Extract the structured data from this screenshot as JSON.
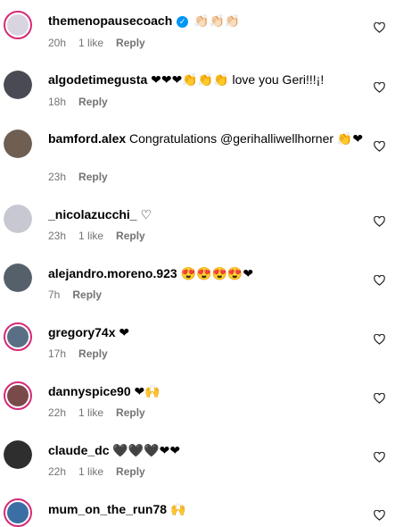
{
  "comments": [
    {
      "username": "themenopausecoach",
      "verified": true,
      "text": "👏🏻👏🏻👏🏻",
      "time": "20h",
      "likes": "1 like",
      "reply": "Reply",
      "avatar_color": "#d9d5e0"
    },
    {
      "username": "algodetimegusta",
      "verified": false,
      "text": "❤❤❤👏👏👏 love you Geri!!!¡!",
      "time": "18h",
      "likes": "",
      "reply": "Reply",
      "avatar_color": "#4a4a55"
    },
    {
      "username": "bamford.alex",
      "verified": false,
      "text": "Congratulations @gerihalliwellhorner 👏❤",
      "time": "23h",
      "likes": "",
      "reply": "Reply",
      "avatar_color": "#6e5f52"
    },
    {
      "username": "_nicolazucchi_",
      "verified": false,
      "text": "♡",
      "time": "23h",
      "likes": "1 like",
      "reply": "Reply",
      "avatar_color": "#c8c8d2"
    },
    {
      "username": "alejandro.moreno.923",
      "verified": false,
      "text": "😍😍😍😍❤",
      "time": "7h",
      "likes": "",
      "reply": "Reply",
      "avatar_color": "#55606a"
    },
    {
      "username": "gregory74x",
      "verified": false,
      "text": "❤",
      "time": "17h",
      "likes": "",
      "reply": "Reply",
      "avatar_color": "#5a6f85"
    },
    {
      "username": "dannyspice90",
      "verified": false,
      "text": "❤🙌",
      "time": "22h",
      "likes": "1 like",
      "reply": "Reply",
      "avatar_color": "#7a4a4a"
    },
    {
      "username": "claude_dc",
      "verified": false,
      "text": "🖤🖤🖤❤❤",
      "time": "22h",
      "likes": "1 like",
      "reply": "Reply",
      "avatar_color": "#2e2e2e"
    },
    {
      "username": "mum_on_the_run78",
      "verified": false,
      "text": "🙌",
      "time": "",
      "likes": "",
      "reply": "",
      "avatar_color": "#3a6ea5"
    }
  ],
  "icons": {
    "like": "heart-outline-icon",
    "verified": "verified-badge-icon"
  },
  "colors": {
    "story_ring": "#d62976",
    "meta_text": "#737373",
    "verified_blue": "#0095f6"
  }
}
